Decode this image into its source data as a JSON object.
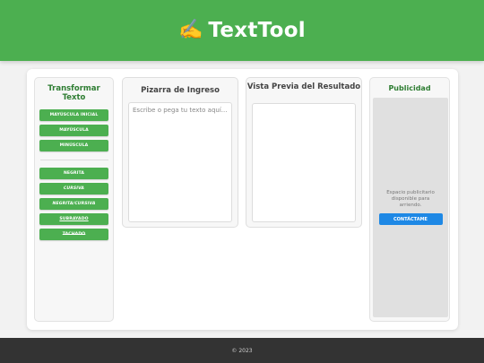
{
  "header": {
    "logo_icon": "writing-hand-icon",
    "logo_glyph": "✍️",
    "title": "TextTool"
  },
  "sidebar": {
    "title": "Transformar Texto",
    "case_buttons": [
      "MAYÚSCULA INICIAL",
      "MAYÚSCULA",
      "MINÚSCULA"
    ],
    "style_buttons": [
      "NEGRITA",
      "CURSIVA",
      "NEGRITA/CURSIVA",
      "SUBRAYADO",
      "TACHADO"
    ]
  },
  "input_panel": {
    "title": "Pizarra de Ingreso",
    "placeholder": "Escribe o pega tu texto aquí...",
    "value": ""
  },
  "preview_panel": {
    "title": "Vista Previa del Resultado",
    "content": ""
  },
  "ad_panel": {
    "title": "Publicidad",
    "text": "Espacio publicitario disponible para arriendo.",
    "button_label": "CONTÁCTAME"
  },
  "footer": {
    "text": "© 2023"
  },
  "colors": {
    "brand_green": "#4caf50",
    "title_green": "#2e7d32",
    "contact_blue": "#1e88e5",
    "footer_bg": "#333333"
  }
}
